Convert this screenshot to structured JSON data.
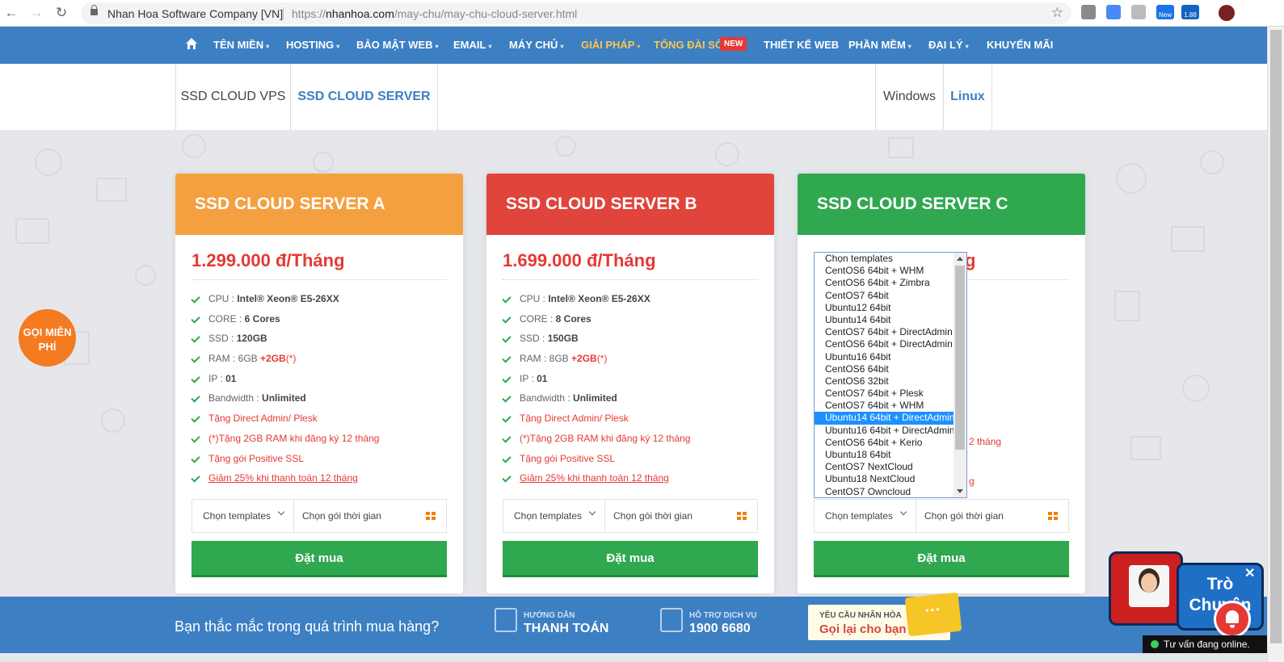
{
  "browser": {
    "site_name": "Nhan Hoa Software Company [VN]",
    "url_prefix": "https://",
    "url_domain": "nhanhoa.com",
    "url_path": "/may-chu/may-chu-cloud-server.html",
    "ext_new_label": "New",
    "ext_count": "1.88"
  },
  "nav": {
    "items": [
      "TÊN MIỀN",
      "HOSTING",
      "BẢO MẬT WEB",
      "EMAIL",
      "MÁY CHỦ",
      "GIẢI PHÁP",
      "TỔNG ĐÀI SỐ",
      "THIẾT KẾ WEB",
      "PHẦN MỀM",
      "ĐẠI LÝ",
      "KHUYẾN MÃI"
    ],
    "new_badge": "NEW",
    "highlight_color": "#f9c74f"
  },
  "subtabs": {
    "left": [
      "SSD CLOUD VPS",
      "SSD CLOUD SERVER"
    ],
    "right": [
      "Windows",
      "Linux"
    ]
  },
  "free_call": "GỌI MIỄN PHÍ",
  "cards": [
    {
      "title": "SSD CLOUD SERVER A",
      "color": "#f4a040",
      "price": "1.299.000 đ/Tháng",
      "cpu_label": "CPU : ",
      "cpu": "Intel® Xeon® E5-26XX",
      "core_label": "CORE : ",
      "core": "6 Cores",
      "ssd_label": "SSD : ",
      "ssd": "120GB",
      "ram_label": "RAM : ",
      "ram": "6GB",
      "ram_bonus": "+2GB",
      "ram_note": "(*)",
      "ip_label": "IP : ",
      "ip": "01",
      "bw_label": "Bandwidth : ",
      "bw": "Unlimited",
      "gift1": "Tặng Direct Admin/ Plesk",
      "gift2": "(*)Tặng 2GB RAM khi đăng ký 12 tháng",
      "gift3": "Tặng gói Positive SSL",
      "gift4": "Giảm 25% khi thanh toán 12 tháng",
      "select_template": "Chọn templates",
      "select_period": "Chọn gói thời gian",
      "buy": "Đặt mua"
    },
    {
      "title": "SSD CLOUD SERVER B",
      "color": "#e0443a",
      "price": "1.699.000 đ/Tháng",
      "cpu_label": "CPU : ",
      "cpu": "Intel® Xeon® E5-26XX",
      "core_label": "CORE : ",
      "core": "8 Cores",
      "ssd_label": "SSD : ",
      "ssd": "150GB",
      "ram_label": "RAM : ",
      "ram": "8GB",
      "ram_bonus": "+2GB",
      "ram_note": "(*)",
      "ip_label": "IP : ",
      "ip": "01",
      "bw_label": "Bandwidth : ",
      "bw": "Unlimited",
      "gift1": "Tặng Direct Admin/ Plesk",
      "gift2": "(*)Tặng 2GB RAM khi đăng ký 12 tháng",
      "gift3": "Tặng gói Positive SSL",
      "gift4": "Giảm 25% khi thanh toán 12 tháng",
      "select_template": "Chọn templates",
      "select_period": "Chọn gói thời gian",
      "buy": "Đặt mua"
    },
    {
      "title": "SSD CLOUD SERVER C",
      "color": "#2fa84f",
      "price_tail": "g",
      "gift2_tail": "2 tháng",
      "gift4_tail": "g",
      "select_template": "Chọn templates",
      "select_period": "Chọn gói thời gian",
      "buy": "Đặt mua"
    }
  ],
  "dropdown": {
    "options": [
      "Chọn templates",
      "CentOS6 64bit + WHM",
      "CentOS6 64bit + Zimbra",
      "CentOS7 64bit",
      "Ubuntu12 64bit",
      "Ubuntu14 64bit",
      "CentOS7 64bit + DirectAdmin",
      "CentOS6 64bit + DirectAdmin",
      "Ubuntu16 64bit",
      "CentOS6 64bit",
      "CentOS6 32bit",
      "CentOS7 64bit + Plesk",
      "CentOS7 64bit + WHM",
      "Ubuntu14 64bit + DirectAdmin",
      "Ubuntu16 64bit + DirectAdmin",
      "CentOS6 64bit + Kerio",
      "Ubuntu18 64bit",
      "CentOS7 NextCloud",
      "Ubuntu18 NextCloud",
      "CentOS7 Owncloud"
    ],
    "highlighted": "Ubuntu14 64bit + DirectAdmin"
  },
  "footer": {
    "question": "Bạn thắc mắc trong quá trình mua hàng?",
    "guide_small": "HƯỚNG DẪN",
    "guide_big": "THANH TOÁN",
    "support_small": "HỖ TRỢ DỊCH VỤ",
    "support_big": "1900 6680",
    "callback_small": "YÊU CẦU NHÂN HÒA",
    "callback_big": "Gọi lại cho bạn",
    "bubble": "···"
  },
  "chat": {
    "line1": "Trò",
    "line2": "Chuyện",
    "close": "✕",
    "status": "Tư vấn đang online."
  }
}
